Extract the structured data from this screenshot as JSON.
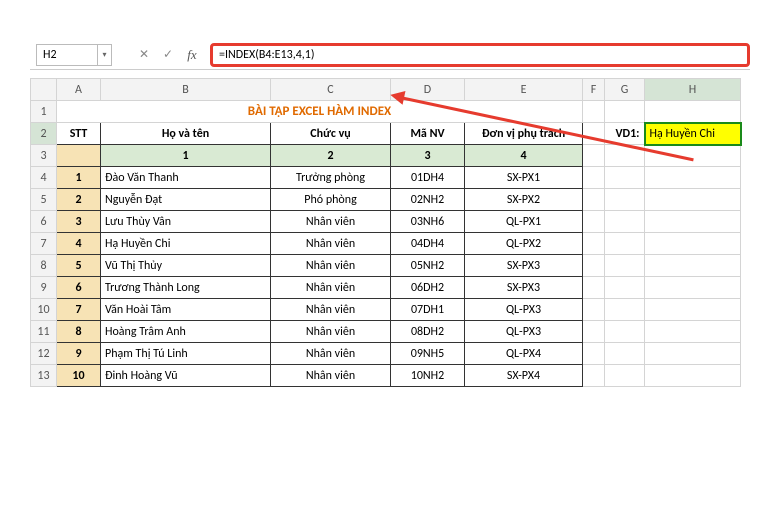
{
  "namebox": {
    "value": "H2"
  },
  "formula_bar": {
    "cancel_symbol": "✕",
    "enter_symbol": "✓",
    "fx_label": "fx",
    "formula": "=INDEX(B4:E13,4,1)"
  },
  "columns": [
    "A",
    "B",
    "C",
    "D",
    "E",
    "F",
    "G",
    "H"
  ],
  "row_numbers": [
    1,
    2,
    3,
    4,
    5,
    6,
    7,
    8,
    9,
    10,
    11,
    12,
    13
  ],
  "title": "BÀI TẬP EXCEL HÀM INDEX",
  "headers": {
    "stt": "STT",
    "hoten": "Họ và tên",
    "chucvu": "Chức vụ",
    "manv": "Mã NV",
    "donvi": "Đơn vị phụ trách"
  },
  "subheaders": [
    "1",
    "2",
    "3",
    "4"
  ],
  "rows": [
    {
      "stt": "1",
      "hoten": "Đào Văn Thanh",
      "chucvu": "Trưởng phòng",
      "manv": "01DH4",
      "donvi": "SX-PX1"
    },
    {
      "stt": "2",
      "hoten": "Nguyễn Đạt",
      "chucvu": "Phó phòng",
      "manv": "02NH2",
      "donvi": "SX-PX2"
    },
    {
      "stt": "3",
      "hoten": "Lưu Thùy Vân",
      "chucvu": "Nhân viên",
      "manv": "03NH6",
      "donvi": "QL-PX1"
    },
    {
      "stt": "4",
      "hoten": "Hạ Huyền Chi",
      "chucvu": "Nhân viên",
      "manv": "04DH4",
      "donvi": "QL-PX2"
    },
    {
      "stt": "5",
      "hoten": "Vũ Thị Thủy",
      "chucvu": "Nhân viên",
      "manv": "05NH2",
      "donvi": "SX-PX3"
    },
    {
      "stt": "6",
      "hoten": "Trương Thành Long",
      "chucvu": "Nhân viên",
      "manv": "06DH2",
      "donvi": "SX-PX3"
    },
    {
      "stt": "7",
      "hoten": "Văn Hoài Tâm",
      "chucvu": "Nhân viên",
      "manv": "07DH1",
      "donvi": "QL-PX3"
    },
    {
      "stt": "8",
      "hoten": "Hoàng Trâm Anh",
      "chucvu": "Nhân viên",
      "manv": "08DH2",
      "donvi": "QL-PX3"
    },
    {
      "stt": "9",
      "hoten": "Phạm Thị Tú Linh",
      "chucvu": "Nhân viên",
      "manv": "09NH5",
      "donvi": "QL-PX4"
    },
    {
      "stt": "10",
      "hoten": "Đinh Hoàng Vũ",
      "chucvu": "Nhân viên",
      "manv": "10NH2",
      "donvi": "SX-PX4"
    }
  ],
  "vd1_label": "VD1:",
  "result_value": "Hạ Huyền Chi",
  "active_cell": "H2",
  "chart_data": {
    "type": "table",
    "title": "BÀI TẬP EXCEL HÀM INDEX",
    "columns": [
      "STT",
      "Họ và tên",
      "Chức vụ",
      "Mã NV",
      "Đơn vị phụ trách"
    ],
    "data": [
      [
        1,
        "Đào Văn Thanh",
        "Trưởng phòng",
        "01DH4",
        "SX-PX1"
      ],
      [
        2,
        "Nguyễn Đạt",
        "Phó phòng",
        "02NH2",
        "SX-PX2"
      ],
      [
        3,
        "Lưu Thùy Vân",
        "Nhân viên",
        "03NH6",
        "QL-PX1"
      ],
      [
        4,
        "Hạ Huyền Chi",
        "Nhân viên",
        "04DH4",
        "QL-PX2"
      ],
      [
        5,
        "Vũ Thị Thủy",
        "Nhân viên",
        "05NH2",
        "SX-PX3"
      ],
      [
        6,
        "Trương Thành Long",
        "Nhân viên",
        "06DH2",
        "SX-PX3"
      ],
      [
        7,
        "Văn Hoài Tâm",
        "Nhân viên",
        "07DH1",
        "QL-PX3"
      ],
      [
        8,
        "Hoàng Trâm Anh",
        "Nhân viên",
        "08DH2",
        "QL-PX3"
      ],
      [
        9,
        "Phạm Thị Tú Linh",
        "Nhân viên",
        "09NH5",
        "QL-PX4"
      ],
      [
        10,
        "Đinh Hoàng Vũ",
        "Nhân viên",
        "10NH2",
        "SX-PX4"
      ]
    ],
    "formula": "=INDEX(B4:E13,4,1)",
    "formula_result": "Hạ Huyền Chi"
  }
}
